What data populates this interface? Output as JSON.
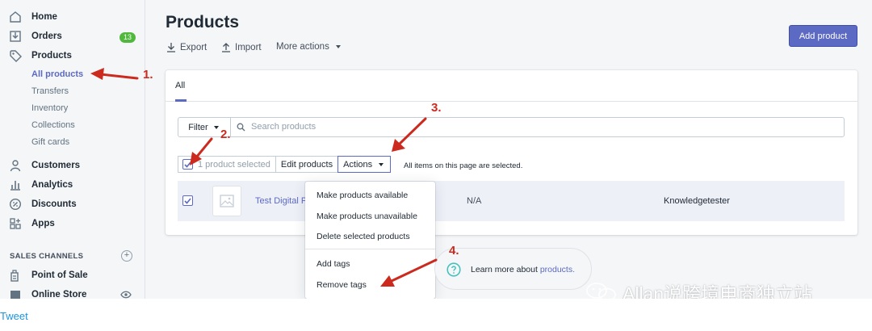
{
  "sidebar": {
    "home": "Home",
    "orders": "Orders",
    "orders_badge": "13",
    "products": "Products",
    "products_sub": [
      "All products",
      "Transfers",
      "Inventory",
      "Collections",
      "Gift cards"
    ],
    "customers": "Customers",
    "analytics": "Analytics",
    "discounts": "Discounts",
    "apps": "Apps",
    "channels_heading": "SALES CHANNELS",
    "point_of_sale": "Point of Sale",
    "online_store": "Online Store"
  },
  "header": {
    "title": "Products",
    "export": "Export",
    "import": "Import",
    "more_actions": "More actions",
    "add_product": "Add product"
  },
  "tabs": {
    "all": "All"
  },
  "toolbar": {
    "filter": "Filter",
    "search_placeholder": "Search products",
    "selected_count": "1 product selected",
    "edit_products": "Edit products",
    "actions": "Actions",
    "all_selected_msg": "All items on this page are selected."
  },
  "table": {
    "rows": [
      {
        "name": "Test Digital P",
        "col2": "N/A",
        "vendor": "Knowledgetester",
        "selected": true
      }
    ]
  },
  "actions_menu": {
    "items": [
      "Make products available",
      "Make products unavailable",
      "Delete selected products"
    ],
    "tag_items": [
      "Add tags",
      "Remove tags"
    ]
  },
  "learn_more": {
    "text": "Learn more about ",
    "link": "products."
  },
  "annotations": [
    "1.",
    "2.",
    "3.",
    "4."
  ],
  "watermark": "Allan说跨境电商独立站",
  "tweet": "Tweet",
  "colors": {
    "accent": "#5c6ac4",
    "arrow": "#cc2a1e",
    "badge": "#50b83c",
    "link": "#1b95e0"
  }
}
